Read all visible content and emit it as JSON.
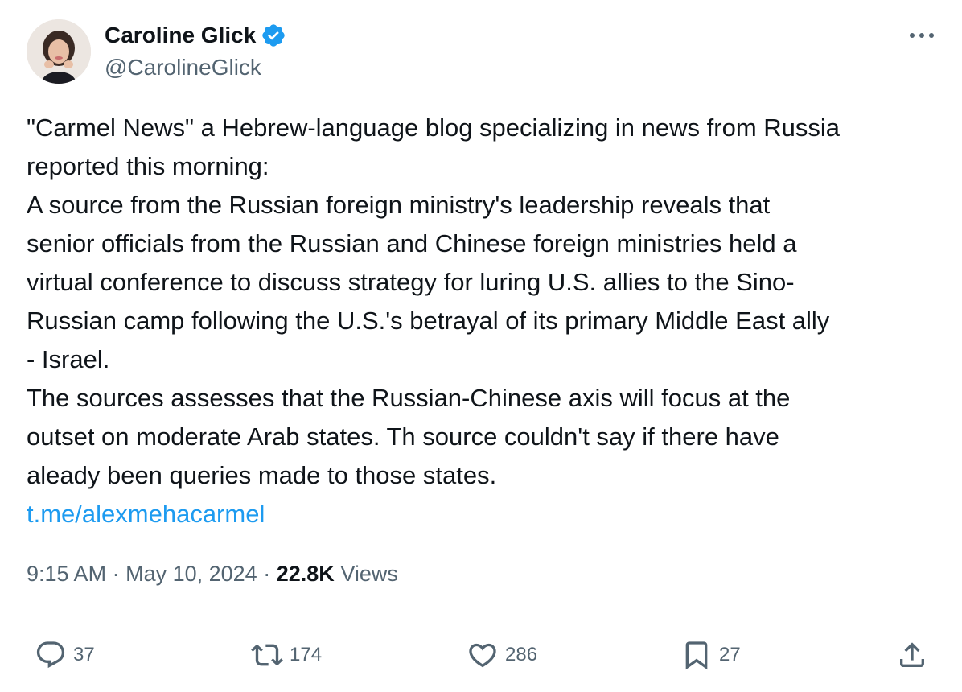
{
  "author": {
    "display_name": "Caroline Glick",
    "handle": "@CarolineGlick",
    "verified": true,
    "avatar_icon": "profile-photo"
  },
  "tweet": {
    "lines": [
      "\"Carmel News\" a Hebrew-language blog specializing in news from Russia",
      "reported this morning:",
      "A source from the Russian foreign ministry's leadership reveals that",
      "senior officials from the Russian and Chinese foreign ministries held a",
      "virtual conference to discuss strategy for luring U.S. allies to the Sino-",
      "Russian camp following the U.S.'s betrayal of its primary Middle East ally",
      "- Israel.",
      "The sources assesses that the Russian-Chinese axis will focus at the",
      "outset on moderate Arab states. Th source couldn't say if there have",
      "aleady been queries made to those states."
    ],
    "link": "t.me/alexmehacarmel"
  },
  "meta": {
    "time": "9:15 AM",
    "separator": "·",
    "date": "May 10, 2024",
    "views_count": "22.8K",
    "views_label": "Views"
  },
  "actions": {
    "replies": "37",
    "reposts": "174",
    "likes": "286",
    "bookmarks": "27"
  },
  "colors": {
    "text": "#0f1419",
    "secondary": "#536471",
    "link": "#1d9bf0",
    "verified": "#1d9bf0",
    "divider": "#eff3f4"
  }
}
